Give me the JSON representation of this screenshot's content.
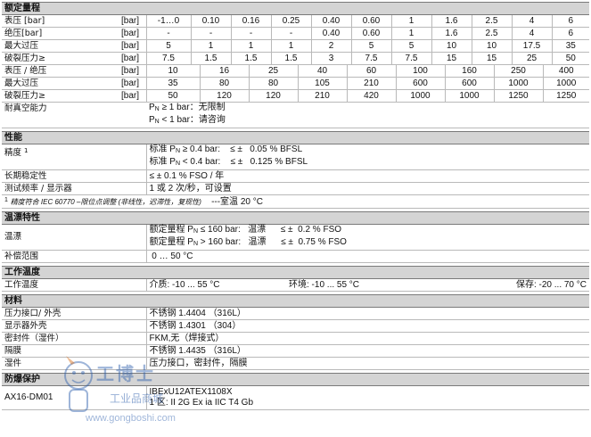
{
  "sections": {
    "rated_range": "额定量程",
    "performance": "性能",
    "temperature": "温漂特性",
    "working_temp": "工作温度",
    "material": "材料",
    "explosion": "防爆保护"
  },
  "range_table_1": {
    "unit": "[bar]",
    "rows": [
      {
        "label": "表压 [bar]",
        "values": [
          "-1…0",
          "0.10",
          "0.16",
          "0.25",
          "0.40",
          "0.60",
          "1",
          "1.6",
          "2.5",
          "4",
          "6"
        ]
      },
      {
        "label": "绝压[bar]",
        "values": [
          "-",
          "-",
          "-",
          "-",
          "0.40",
          "0.60",
          "1",
          "1.6",
          "2.5",
          "4",
          "6"
        ]
      },
      {
        "label": "最大过压",
        "values": [
          "5",
          "1",
          "1",
          "1",
          "2",
          "5",
          "5",
          "10",
          "10",
          "17.5",
          "35"
        ]
      },
      {
        "label": "破裂压力≥",
        "values": [
          "7.5",
          "1.5",
          "1.5",
          "1.5",
          "3",
          "7.5",
          "7.5",
          "15",
          "15",
          "25",
          "50"
        ]
      }
    ]
  },
  "range_table_2": {
    "unit": "[bar]",
    "rows": [
      {
        "label": "表压 / 绝压",
        "values": [
          "10",
          "16",
          "25",
          "40",
          "60",
          "100",
          "160",
          "250",
          "400"
        ]
      },
      {
        "label": "最大过压",
        "values": [
          "35",
          "80",
          "80",
          "105",
          "210",
          "600",
          "600",
          "1000",
          "1000"
        ]
      },
      {
        "label": "破裂压力≥",
        "values": [
          "50",
          "120",
          "120",
          "210",
          "420",
          "1000",
          "1000",
          "1250",
          "1250"
        ]
      }
    ]
  },
  "vacuum": {
    "label": "耐真空能力",
    "line1": {
      "p": "P",
      "sub": "N",
      "text": " ≥ 1 bar：无限制"
    },
    "line2": {
      "p": "P",
      "sub": "N",
      "text": " < 1 bar：请咨询"
    }
  },
  "accuracy": {
    "label": "精度",
    "sup": "1",
    "line1": {
      "pre": "标准 P",
      "sub": "N",
      "mid": " ≥ 0.4 bar:",
      "pm": "≤ ±",
      "val": "0.05 % BFSL"
    },
    "line2": {
      "pre": "标准 P",
      "sub": "N",
      "mid": " < 0.4 bar:",
      "pm": "≤ ±",
      "val": "0.125 % BFSL"
    }
  },
  "stability": {
    "label": "长期稳定性",
    "value": "≤ ± 0.1 % FSO / 年"
  },
  "frequency": {
    "label": "测试频率 / 显示器",
    "value": "1 或 2 次/秒，可设置"
  },
  "footnote": {
    "sup": "1",
    "text": "精度符合 IEC 60770 –限位点调整 (非线性，迟滞性，复现性)",
    "room": "---室温  20 °C"
  },
  "temp_drift": {
    "label": "温漂",
    "line1": {
      "pre": "额定量程 P",
      "sub": "N",
      "mid": " ≤ 160 bar:",
      "name": "温漂",
      "pm": "≤ ±",
      "val": "0.2 % FSO"
    },
    "line2": {
      "pre": "额定量程 P",
      "sub": "N",
      "mid": " > 160 bar:",
      "name": "温漂",
      "pm": "≤ ±",
      "val": "0.75 % FSO"
    }
  },
  "compensation": {
    "label": "补偿范围",
    "value": "0 … 50 °C"
  },
  "working": {
    "label": "工作温度",
    "medium": "介质:  -10 ... 55 °C",
    "ambient": "环境:  -10 ... 55 °C",
    "storage": "保存:  -20 ... 70 °C"
  },
  "materials": [
    {
      "label": "压力接口/ 外壳",
      "value": "不锈钢 1.4404 （316L）"
    },
    {
      "label": "显示器外壳",
      "value": "不锈钢 1.4301 （304）"
    },
    {
      "label": "密封件（湿件）",
      "value": "FKM,无（焊接式）"
    },
    {
      "label": "隔膜",
      "value": "不锈钢 1.4435 （316L）"
    },
    {
      "label": "湿件",
      "value": "压力接口，密封件，隔膜"
    }
  ],
  "explosion_row": {
    "label": "AX16-DM01",
    "line1": "IBExU12ATEX1108X",
    "line2": "1 区: II 2G Ex ia IIC T4 Gb"
  },
  "watermark": {
    "cn": "工博士",
    "cn2": "工业品商城",
    "url": "www.gongboshi.com"
  }
}
